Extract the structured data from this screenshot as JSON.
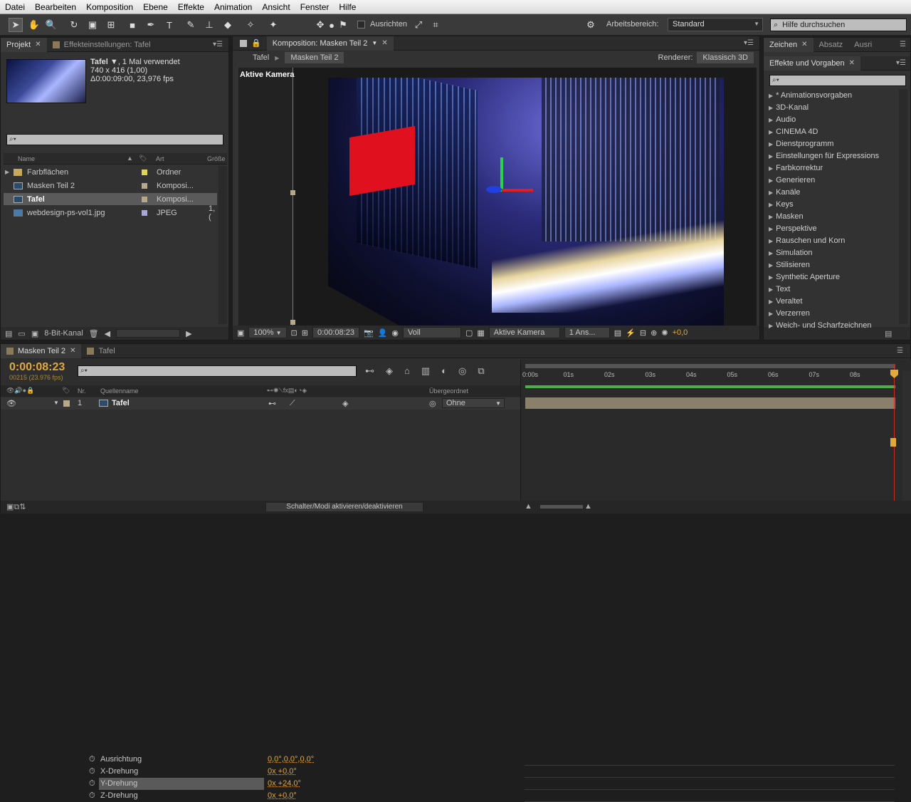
{
  "menu": [
    "Datei",
    "Bearbeiten",
    "Komposition",
    "Ebene",
    "Effekte",
    "Animation",
    "Ansicht",
    "Fenster",
    "Hilfe"
  ],
  "toolbar": {
    "ausrichten": "Ausrichten",
    "arbeitsbereich_label": "Arbeitsbereich:",
    "arbeitsbereich_value": "Standard",
    "help_placeholder": "Hilfe durchsuchen"
  },
  "project": {
    "tab": "Projekt",
    "tab2": "Effekteinstellungen: Tafel",
    "item_name": "Tafel ▼",
    "item_usage": ", 1 Mal verwendet",
    "item_size": "740 x 416 (1,00)",
    "item_duration": "Δ0:00:09:00, 23,976 fps",
    "col_name": "Name",
    "col_type": "Art",
    "col_size": "Größe",
    "items": [
      {
        "name": "Farbflächen",
        "type": "Ordner",
        "size": "",
        "color": "#e0d45a"
      },
      {
        "name": "Masken Teil 2",
        "type": "Komposi...",
        "size": "",
        "color": "#b8a88a"
      },
      {
        "name": "Tafel",
        "type": "Komposi...",
        "size": "",
        "color": "#b8a88a"
      },
      {
        "name": "webdesign-ps-vol1.jpg",
        "type": "JPEG",
        "size": "1,(",
        "color": "#a8a8d8"
      }
    ],
    "bit_depth": "8-Bit-Kanal"
  },
  "comp": {
    "tab": "Komposition: Masken Teil 2",
    "breadcrumb1": "Tafel",
    "breadcrumb2": "Masken Teil 2",
    "renderer_label": "Renderer:",
    "renderer_value": "Klassisch 3D",
    "view_label": "Aktive Kamera",
    "zoom": "100%",
    "timecode": "0:00:08:23",
    "resolution": "Voll",
    "camera": "Aktive Kamera",
    "views": "1 Ans...",
    "exposure": "+0,0"
  },
  "right": {
    "tab1": "Zeichen",
    "tab2": "Absatz",
    "tab3": "Ausri",
    "effects_title": "Effekte und Vorgaben",
    "effects": [
      "* Animationsvorgaben",
      "3D-Kanal",
      "Audio",
      "CINEMA 4D",
      "Dienstprogramm",
      "Einstellungen für Expressions",
      "Farbkorrektur",
      "Generieren",
      "Kanäle",
      "Keys",
      "Masken",
      "Perspektive",
      "Rauschen und Korn",
      "Simulation",
      "Stilisieren",
      "Synthetic Aperture",
      "Text",
      "Veraltet",
      "Verzerren",
      "Weich- und Scharfzeichnen"
    ]
  },
  "timeline": {
    "tab1": "Masken Teil 2",
    "tab2": "Tafel",
    "timecode": "0:00:08:23",
    "frame_info": "00215 (23.976 fps)",
    "col_nr": "Nr.",
    "col_source": "Quellenname",
    "col_parent": "Übergeordnet",
    "layer_nr": "1",
    "layer_name": "Tafel",
    "parent_value": "Ohne",
    "props": [
      {
        "name": "Ausrichtung",
        "value": "0,0°,0,0°,0,0°"
      },
      {
        "name": "X-Drehung",
        "value": "0x +0,0°"
      },
      {
        "name": "Y-Drehung",
        "value": "0x +24,0°"
      },
      {
        "name": "Z-Drehung",
        "value": "0x +0,0°"
      }
    ],
    "ruler": [
      "0:00s",
      "01s",
      "02s",
      "03s",
      "04s",
      "05s",
      "06s",
      "07s",
      "08s"
    ],
    "switch_button": "Schalter/Modi aktivieren/deaktivieren"
  }
}
